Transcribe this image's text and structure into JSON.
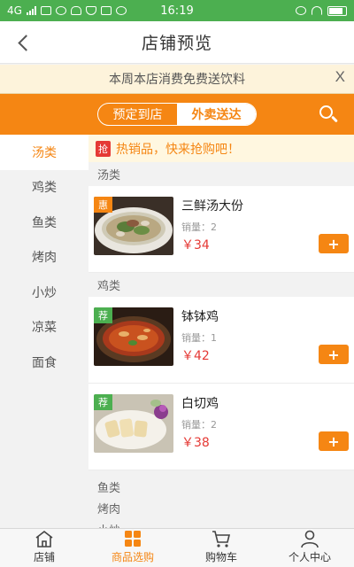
{
  "status_bar": {
    "network": "4G",
    "time": "16:19"
  },
  "nav": {
    "title": "店铺预览"
  },
  "notice": {
    "text": "本周本店消费免费送饮料",
    "close": "X"
  },
  "mode": {
    "options": [
      "预定到店",
      "外卖送达"
    ],
    "selected": "外卖送达"
  },
  "sidebar": {
    "items": [
      "汤类",
      "鸡类",
      "鱼类",
      "烤肉",
      "小炒",
      "凉菜",
      "面食"
    ],
    "active": "汤类"
  },
  "promo": {
    "badge": "抢",
    "text": "热销品，快来抢购吧！"
  },
  "sections": [
    {
      "title": "汤类",
      "dishes": [
        {
          "tag": "惠",
          "name": "三鲜汤大份",
          "sales": "销量：2",
          "price": "￥34"
        }
      ]
    },
    {
      "title": "鸡类",
      "dishes": [
        {
          "tag": "荐",
          "name": "钵钵鸡",
          "sales": "销量：1",
          "price": "￥42"
        },
        {
          "tag": "荐",
          "name": "白切鸡",
          "sales": "销量：2",
          "price": "￥38"
        }
      ]
    }
  ],
  "more_sections": [
    "鱼类",
    "烤肉",
    "小炒"
  ],
  "add_button": "+",
  "tabs": [
    {
      "label": "店铺",
      "icon": "store-icon"
    },
    {
      "label": "商品选购",
      "icon": "grid-icon"
    },
    {
      "label": "购物车",
      "icon": "cart-icon"
    },
    {
      "label": "个人中心",
      "icon": "user-icon"
    }
  ],
  "colors": {
    "accent": "#f58613",
    "status_bar": "#4caf50",
    "price": "#e53935",
    "tag_green": "#4caf50"
  }
}
